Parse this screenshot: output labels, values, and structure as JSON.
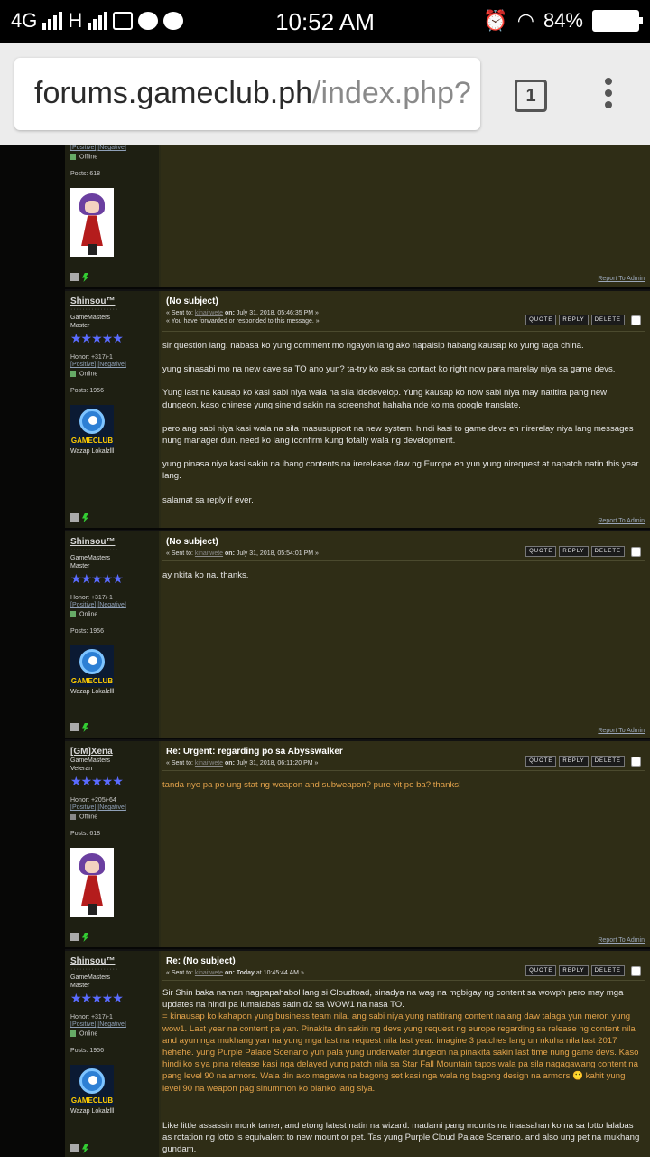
{
  "statusbar": {
    "network": "4G",
    "network2": "H",
    "time": "10:52 AM",
    "battery": "84%"
  },
  "browser": {
    "url_host": "forums.gameclub.ph",
    "url_path": "/index.php?",
    "tab_count": "1"
  },
  "labels": {
    "positive": "[Positive]",
    "negative": "[Negative]",
    "report": "Report To Admin",
    "quote": "QUOTE",
    "reply": "REPLY",
    "delete": "DELETE",
    "sent_to": "« Sent to:",
    "on": "on:",
    "stars": "★★★★★"
  },
  "partial_post": {
    "status": "Offline",
    "posts": "Posts: 618"
  },
  "posts": [
    {
      "username": "Shinsou™",
      "group": "GameMasters",
      "rank": "Master",
      "honor": "Honor: +317/-1",
      "status": "Online",
      "posts": "Posts: 1956",
      "signature": "Wazap Lokalzlll",
      "subject": "(No subject)",
      "recipient": "kinaitwete",
      "date": "July 31, 2018, 05:46:35 PM »",
      "note": "« You have forwarded or responded to this message. »",
      "paragraphs": [
        "sir question lang. nabasa ko yung comment mo ngayon lang ako napaisip habang kausap ko yung taga china.",
        "yung sinasabi mo na new cave sa TO ano yun? ta-try ko ask sa contact ko right now para marelay niya sa game devs.",
        "Yung last na kausap ko kasi sabi niya wala na sila idedevelop. Yung kausap ko now sabi niya may natitira pang new dungeon. kaso chinese yung sinend sakin na screenshot hahaha nde ko ma google translate.",
        "pero ang sabi niya kasi wala na sila masusupport na new system. hindi kasi to game devs eh nirerelay niya lang messages nung manager dun. need ko lang iconfirm kung totally wala ng development.",
        "yung pinasa niya kasi sakin na ibang contents na irerelease daw ng Europe eh yun yung nirequest at napatch natin this year lang.",
        "salamat sa reply if ever."
      ]
    },
    {
      "username": "Shinsou™",
      "group": "GameMasters",
      "rank": "Master",
      "honor": "Honor: +317/-1",
      "status": "Online",
      "posts": "Posts: 1956",
      "signature": "Wazap Lokalzlll",
      "subject": "(No subject)",
      "recipient": "kinaitwete",
      "date": "July 31, 2018, 05:54:01 PM »",
      "paragraphs": [
        "ay nkita ko na. thanks."
      ]
    },
    {
      "username": "[GM]Xena",
      "group": "GameMasters",
      "rank": "Veteran",
      "honor": "Honor: +205/-64",
      "status": "Offline",
      "posts": "Posts: 618",
      "subject": "Re: Urgent: regarding po sa Abysswalker",
      "recipient": "kinaitwete",
      "date": "July 31, 2018, 06:11:20 PM »",
      "paragraphs": [
        "tanda nyo pa po ung stat ng weapon and subweapon? pure vit po ba? thanks!"
      ]
    },
    {
      "username": "Shinsou™",
      "group": "GameMasters",
      "rank": "Master",
      "honor": "Honor: +317/-1",
      "status": "Online",
      "posts": "Posts: 1956",
      "signature": "Wazap Lokalzlll",
      "subject": "Re: (No subject)",
      "recipient": "kinaitwete",
      "date_prefix": "Today",
      "date": " at 10:45:44 AM »",
      "quote_line": "Sir Shin baka naman nagpapahabol lang si Cloudtoad, sinadya na wag na mgbigay ng content sa wowph pero may mga updates na hindi pa lumalabas satin d2 sa WOW1 na nasa TO.",
      "orange": "= kinausap ko kahapon yung business team nila. ang sabi niya yung natitirang content nalang daw talaga yun meron yung wow1. Last year na content pa yan. Pinakita din sakin ng devs yung request ng europe regarding sa release ng content nila and ayun nga mukhang yan na yung mga last na request nila last year. imagine 3 patches lang un nkuha nila last 2017 hehehe. yung Purple Palace Scenario yun pala yung underwater dungeon na pinakita sakin last time nung game devs. Kaso hindi ko siya pina release kasi nga delayed yung patch nila sa Star Fall Mountain tapos wala pa sila nagagawang content na pang level 90 na armors. Wala din ako magawa na bagong set kasi nga wala ng bagong design na armors",
      "orange_tail": " kahit yung level 90 na weapon pag sinummon ko blanko lang siya.",
      "last": "Like little assassin monk tamer, and etong latest natin na wizard. madami pang mounts na inaasahan ko na sa lotto lalabas as rotation ng lotto is equivalent to new mount or pet. Tas yung Purple Cloud Palace Scenario. and also ung pet na mukhang gundam."
    }
  ]
}
